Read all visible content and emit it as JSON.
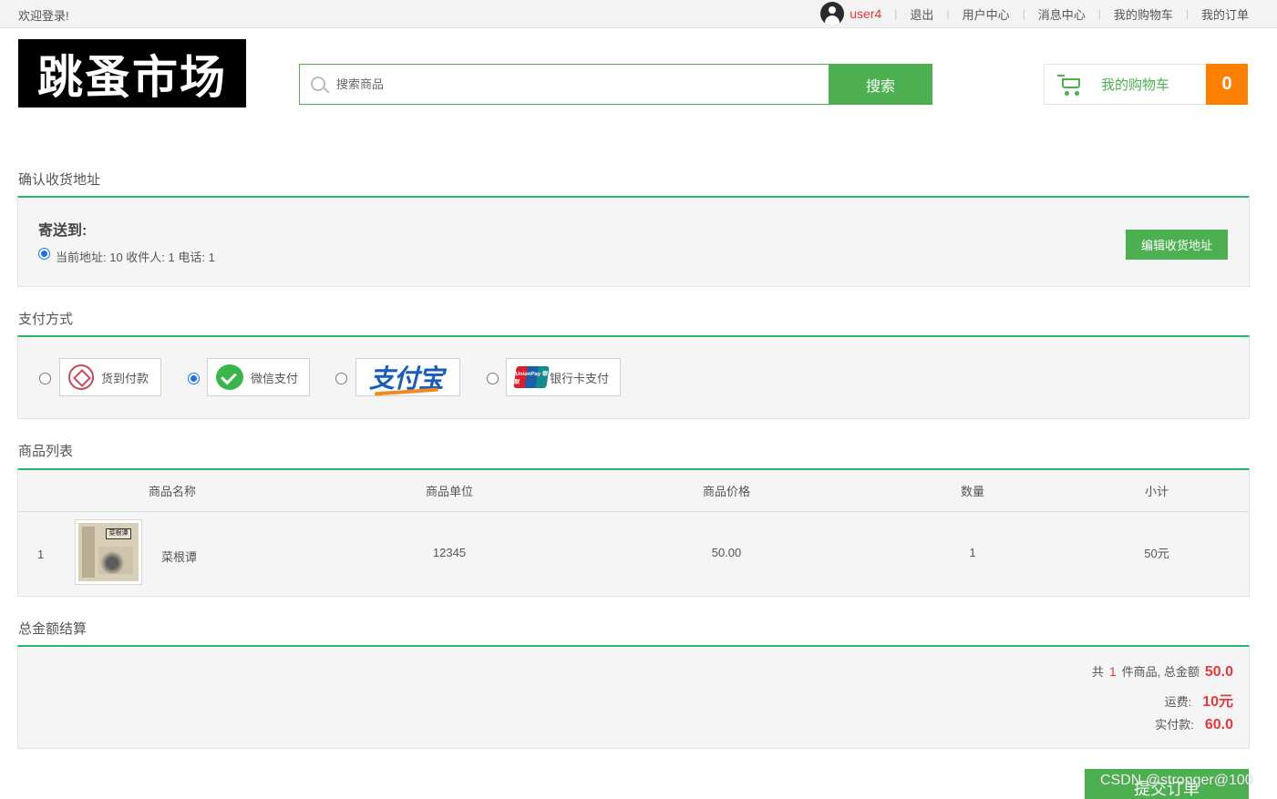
{
  "topbar": {
    "welcome": "欢迎登录!",
    "username": "user4",
    "links": [
      "退出",
      "用户中心",
      "消息中心",
      "我的购物车",
      "我的订单"
    ]
  },
  "header": {
    "logo_text": "跳蚤市场",
    "search_placeholder": "搜索商品",
    "search_button": "搜索",
    "cart_label": "我的购物车",
    "cart_count": "0"
  },
  "address": {
    "section_title": "确认收货地址",
    "heading": "寄送到:",
    "current": "当前地址: 10 收件人: 1 电话: 1",
    "edit_button": "编辑收货地址"
  },
  "payment": {
    "section_title": "支付方式",
    "options": [
      {
        "label": "货到付款",
        "icon": "cash-on-delivery-icon",
        "selected": false
      },
      {
        "label": "微信支付",
        "icon": "wechat-pay-icon",
        "selected": true
      },
      {
        "label": "支付宝",
        "icon": "alipay-logo",
        "selected": false
      },
      {
        "label": "银行卡支付",
        "icon": "unionpay-icon",
        "selected": false
      }
    ],
    "unionpay_text": "UnionPay 银联"
  },
  "goods": {
    "section_title": "商品列表",
    "columns": [
      "商品名称",
      "商品单位",
      "商品价格",
      "数量",
      "小计"
    ],
    "rows": [
      {
        "index": "1",
        "name": "菜根谭",
        "unit": "12345",
        "price": "50.00",
        "quantity": "1",
        "subtotal": "50元",
        "book_label": "菜根谭"
      }
    ]
  },
  "summary": {
    "section_title": "总金额结算",
    "count_prefix": "共",
    "count": "1",
    "count_suffix": "件商品, 总金额",
    "total": "50.0",
    "shipping_label": "运费:",
    "shipping": "10元",
    "paid_label": "实付款:",
    "paid": "60.0"
  },
  "submit_button": "提交订单",
  "watermark": "CSDN @stronger@100",
  "colors": {
    "accent": "#4caf50",
    "divider": "#29b56f",
    "price": "#e4393c",
    "cart_badge": "#ff8000"
  }
}
